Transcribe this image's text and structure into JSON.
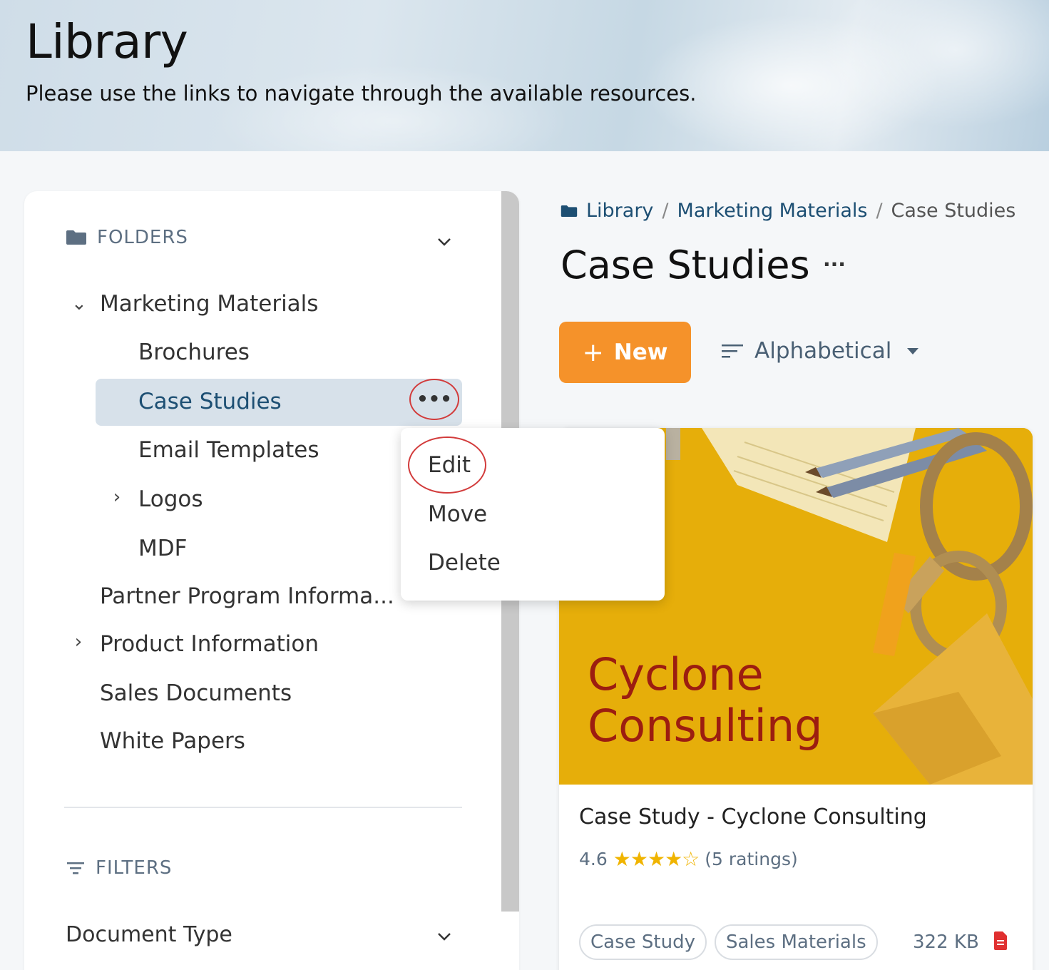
{
  "header": {
    "title": "Library",
    "subtitle": "Please use the links to navigate through the available resources."
  },
  "sidebar": {
    "folders_label": "FOLDERS",
    "filters_label": "FILTERS",
    "items": [
      {
        "label": "Marketing Materials",
        "expanded": true
      },
      {
        "label": "Brochures"
      },
      {
        "label": "Case Studies",
        "selected": true
      },
      {
        "label": "Email Templates"
      },
      {
        "label": "Logos",
        "expandable": true
      },
      {
        "label": "MDF"
      },
      {
        "label": "Partner Program Informa..."
      },
      {
        "label": "Product Information",
        "expandable": true
      },
      {
        "label": "Sales Documents"
      },
      {
        "label": "White Papers"
      }
    ],
    "filter_document_type": "Document Type"
  },
  "context_menu": {
    "items": [
      "Edit",
      "Move",
      "Delete"
    ]
  },
  "breadcrumb": {
    "items": [
      "Library",
      "Marketing Materials",
      "Case Studies"
    ]
  },
  "page": {
    "title": "Case Studies",
    "more": "···",
    "new_button": "New",
    "sort_label": "Alphabetical"
  },
  "card": {
    "image_text_line1": "Cyclone",
    "image_text_line2": "Consulting",
    "title": "Case Study - Cyclone Consulting",
    "rating_value": "4.6",
    "rating_stars": 4.5,
    "rating_count": "(5 ratings)",
    "tags": [
      "Case Study",
      "Sales Materials"
    ],
    "size": "322 KB"
  },
  "colors": {
    "accent_orange": "#f5922a",
    "link_blue": "#1d4f73",
    "highlight_red": "#d23b3b",
    "star_gold": "#f0b400"
  }
}
